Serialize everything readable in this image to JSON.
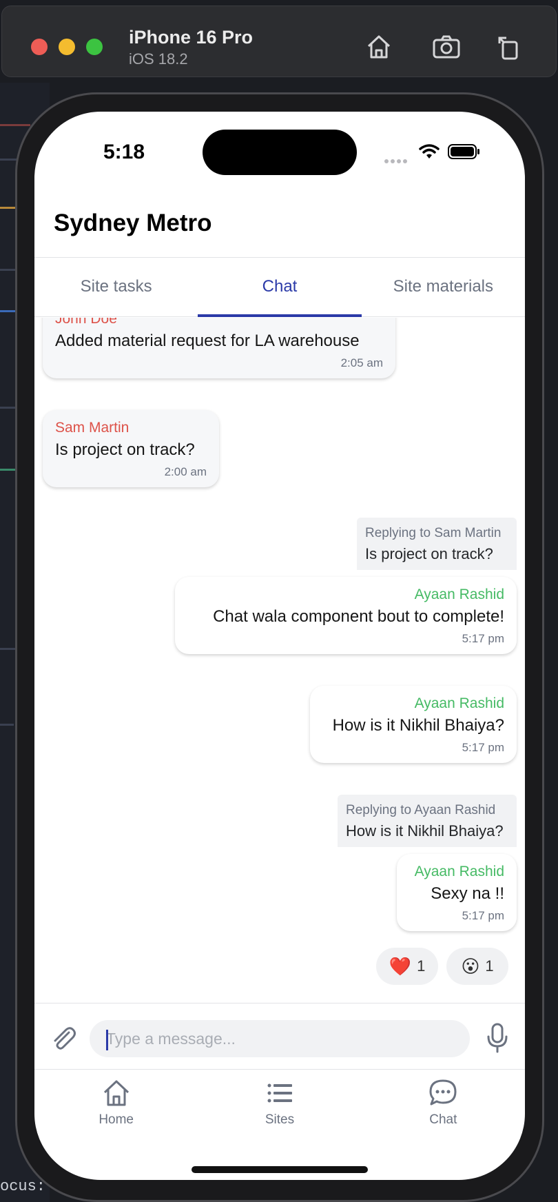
{
  "simulator": {
    "device_name": "iPhone 16 Pro",
    "os_version": "iOS 18.2"
  },
  "background": {
    "focus_text": "ocus: c"
  },
  "status_bar": {
    "time": "5:18"
  },
  "header": {
    "title": "Sydney Metro"
  },
  "tabs": [
    {
      "label": "Site tasks",
      "active": false
    },
    {
      "label": "Chat",
      "active": true
    },
    {
      "label": "Site materials",
      "active": false
    }
  ],
  "messages": [
    {
      "direction": "incoming",
      "sender": "John Doe",
      "text": "Added material request for LA warehouse",
      "time": "2:05 am"
    },
    {
      "direction": "incoming",
      "sender": "Sam Martin",
      "text": "Is project on track?",
      "time": "2:00 am"
    },
    {
      "direction": "outgoing",
      "reply_label": "Replying to Sam Martin",
      "reply_text": "Is project on track?",
      "sender": "Ayaan Rashid",
      "text": "Chat wala component bout to complete!",
      "time": "5:17 pm"
    },
    {
      "direction": "outgoing",
      "sender": "Ayaan Rashid",
      "text": "How is it Nikhil Bhaiya?",
      "time": "5:17 pm"
    },
    {
      "direction": "outgoing",
      "reply_label": "Replying to Ayaan Rashid",
      "reply_text": "How is it Nikhil Bhaiya?",
      "sender": "Ayaan Rashid",
      "text": "Sexy na !!",
      "time": "5:17 pm"
    }
  ],
  "reactions": [
    {
      "emoji": "❤️",
      "count": "1"
    },
    {
      "emoji": "😮",
      "count": "1"
    }
  ],
  "composer": {
    "placeholder": "Type a message..."
  },
  "bottom_nav": [
    {
      "label": "Home",
      "icon": "home-icon"
    },
    {
      "label": "Sites",
      "icon": "list-icon"
    },
    {
      "label": "Chat",
      "icon": "chat-bubble-icon"
    }
  ],
  "colors": {
    "accent": "#2b3aa8",
    "incoming_sender": "#dd5249",
    "outgoing_sender": "#45ba64"
  }
}
